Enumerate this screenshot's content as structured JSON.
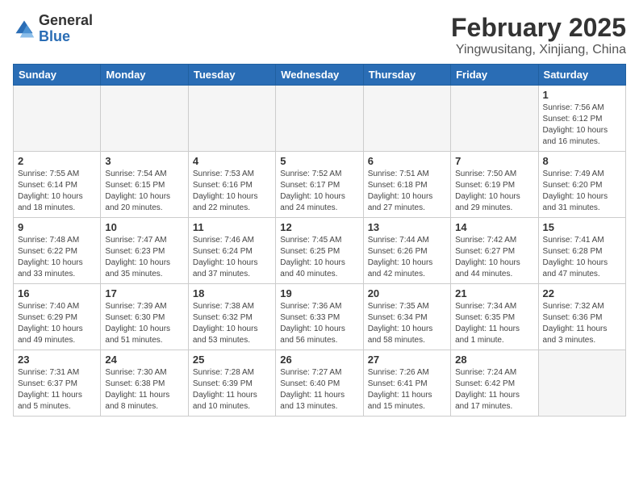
{
  "logo": {
    "general": "General",
    "blue": "Blue"
  },
  "title": {
    "month_year": "February 2025",
    "location": "Yingwusitang, Xinjiang, China"
  },
  "weekdays": [
    "Sunday",
    "Monday",
    "Tuesday",
    "Wednesday",
    "Thursday",
    "Friday",
    "Saturday"
  ],
  "weeks": [
    [
      {
        "day": "",
        "info": ""
      },
      {
        "day": "",
        "info": ""
      },
      {
        "day": "",
        "info": ""
      },
      {
        "day": "",
        "info": ""
      },
      {
        "day": "",
        "info": ""
      },
      {
        "day": "",
        "info": ""
      },
      {
        "day": "1",
        "info": "Sunrise: 7:56 AM\nSunset: 6:12 PM\nDaylight: 10 hours\nand 16 minutes."
      }
    ],
    [
      {
        "day": "2",
        "info": "Sunrise: 7:55 AM\nSunset: 6:14 PM\nDaylight: 10 hours\nand 18 minutes."
      },
      {
        "day": "3",
        "info": "Sunrise: 7:54 AM\nSunset: 6:15 PM\nDaylight: 10 hours\nand 20 minutes."
      },
      {
        "day": "4",
        "info": "Sunrise: 7:53 AM\nSunset: 6:16 PM\nDaylight: 10 hours\nand 22 minutes."
      },
      {
        "day": "5",
        "info": "Sunrise: 7:52 AM\nSunset: 6:17 PM\nDaylight: 10 hours\nand 24 minutes."
      },
      {
        "day": "6",
        "info": "Sunrise: 7:51 AM\nSunset: 6:18 PM\nDaylight: 10 hours\nand 27 minutes."
      },
      {
        "day": "7",
        "info": "Sunrise: 7:50 AM\nSunset: 6:19 PM\nDaylight: 10 hours\nand 29 minutes."
      },
      {
        "day": "8",
        "info": "Sunrise: 7:49 AM\nSunset: 6:20 PM\nDaylight: 10 hours\nand 31 minutes."
      }
    ],
    [
      {
        "day": "9",
        "info": "Sunrise: 7:48 AM\nSunset: 6:22 PM\nDaylight: 10 hours\nand 33 minutes."
      },
      {
        "day": "10",
        "info": "Sunrise: 7:47 AM\nSunset: 6:23 PM\nDaylight: 10 hours\nand 35 minutes."
      },
      {
        "day": "11",
        "info": "Sunrise: 7:46 AM\nSunset: 6:24 PM\nDaylight: 10 hours\nand 37 minutes."
      },
      {
        "day": "12",
        "info": "Sunrise: 7:45 AM\nSunset: 6:25 PM\nDaylight: 10 hours\nand 40 minutes."
      },
      {
        "day": "13",
        "info": "Sunrise: 7:44 AM\nSunset: 6:26 PM\nDaylight: 10 hours\nand 42 minutes."
      },
      {
        "day": "14",
        "info": "Sunrise: 7:42 AM\nSunset: 6:27 PM\nDaylight: 10 hours\nand 44 minutes."
      },
      {
        "day": "15",
        "info": "Sunrise: 7:41 AM\nSunset: 6:28 PM\nDaylight: 10 hours\nand 47 minutes."
      }
    ],
    [
      {
        "day": "16",
        "info": "Sunrise: 7:40 AM\nSunset: 6:29 PM\nDaylight: 10 hours\nand 49 minutes."
      },
      {
        "day": "17",
        "info": "Sunrise: 7:39 AM\nSunset: 6:30 PM\nDaylight: 10 hours\nand 51 minutes."
      },
      {
        "day": "18",
        "info": "Sunrise: 7:38 AM\nSunset: 6:32 PM\nDaylight: 10 hours\nand 53 minutes."
      },
      {
        "day": "19",
        "info": "Sunrise: 7:36 AM\nSunset: 6:33 PM\nDaylight: 10 hours\nand 56 minutes."
      },
      {
        "day": "20",
        "info": "Sunrise: 7:35 AM\nSunset: 6:34 PM\nDaylight: 10 hours\nand 58 minutes."
      },
      {
        "day": "21",
        "info": "Sunrise: 7:34 AM\nSunset: 6:35 PM\nDaylight: 11 hours\nand 1 minute."
      },
      {
        "day": "22",
        "info": "Sunrise: 7:32 AM\nSunset: 6:36 PM\nDaylight: 11 hours\nand 3 minutes."
      }
    ],
    [
      {
        "day": "23",
        "info": "Sunrise: 7:31 AM\nSunset: 6:37 PM\nDaylight: 11 hours\nand 5 minutes."
      },
      {
        "day": "24",
        "info": "Sunrise: 7:30 AM\nSunset: 6:38 PM\nDaylight: 11 hours\nand 8 minutes."
      },
      {
        "day": "25",
        "info": "Sunrise: 7:28 AM\nSunset: 6:39 PM\nDaylight: 11 hours\nand 10 minutes."
      },
      {
        "day": "26",
        "info": "Sunrise: 7:27 AM\nSunset: 6:40 PM\nDaylight: 11 hours\nand 13 minutes."
      },
      {
        "day": "27",
        "info": "Sunrise: 7:26 AM\nSunset: 6:41 PM\nDaylight: 11 hours\nand 15 minutes."
      },
      {
        "day": "28",
        "info": "Sunrise: 7:24 AM\nSunset: 6:42 PM\nDaylight: 11 hours\nand 17 minutes."
      },
      {
        "day": "",
        "info": ""
      }
    ]
  ]
}
